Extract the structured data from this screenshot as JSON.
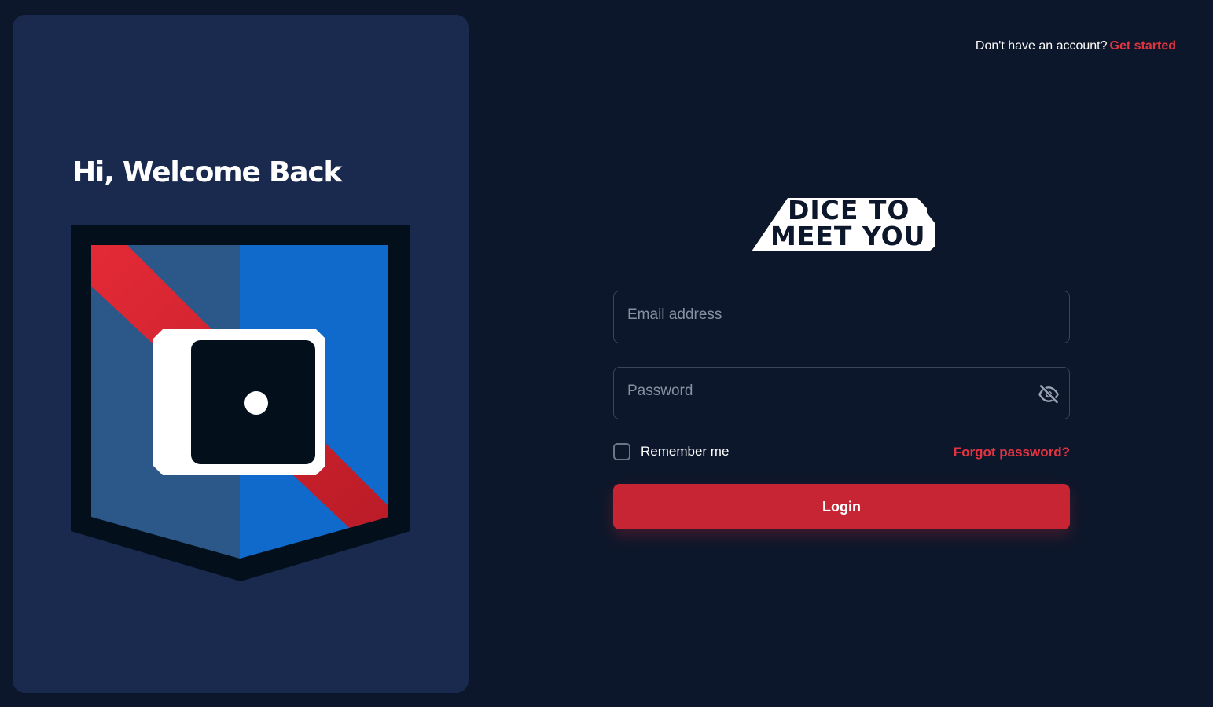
{
  "promo": {
    "title": "Hi, Welcome Back",
    "illustration": "dice-shield-illustration"
  },
  "header": {
    "prompt_text": "Don't have an account?",
    "signup_link": "Get started"
  },
  "logo": {
    "line1": "DICE TO",
    "line2": "MEET YOU"
  },
  "form": {
    "email": {
      "placeholder": "Email address",
      "value": ""
    },
    "password": {
      "placeholder": "Password",
      "value": "",
      "toggle_icon": "eye-off-icon"
    },
    "remember_label": "Remember me",
    "remember_checked": false,
    "forgot_label": "Forgot password?",
    "login_label": "Login"
  },
  "colors": {
    "background": "#0d172b",
    "card": "#1a2a4e",
    "accent": "#c72533",
    "link": "#e03441"
  }
}
